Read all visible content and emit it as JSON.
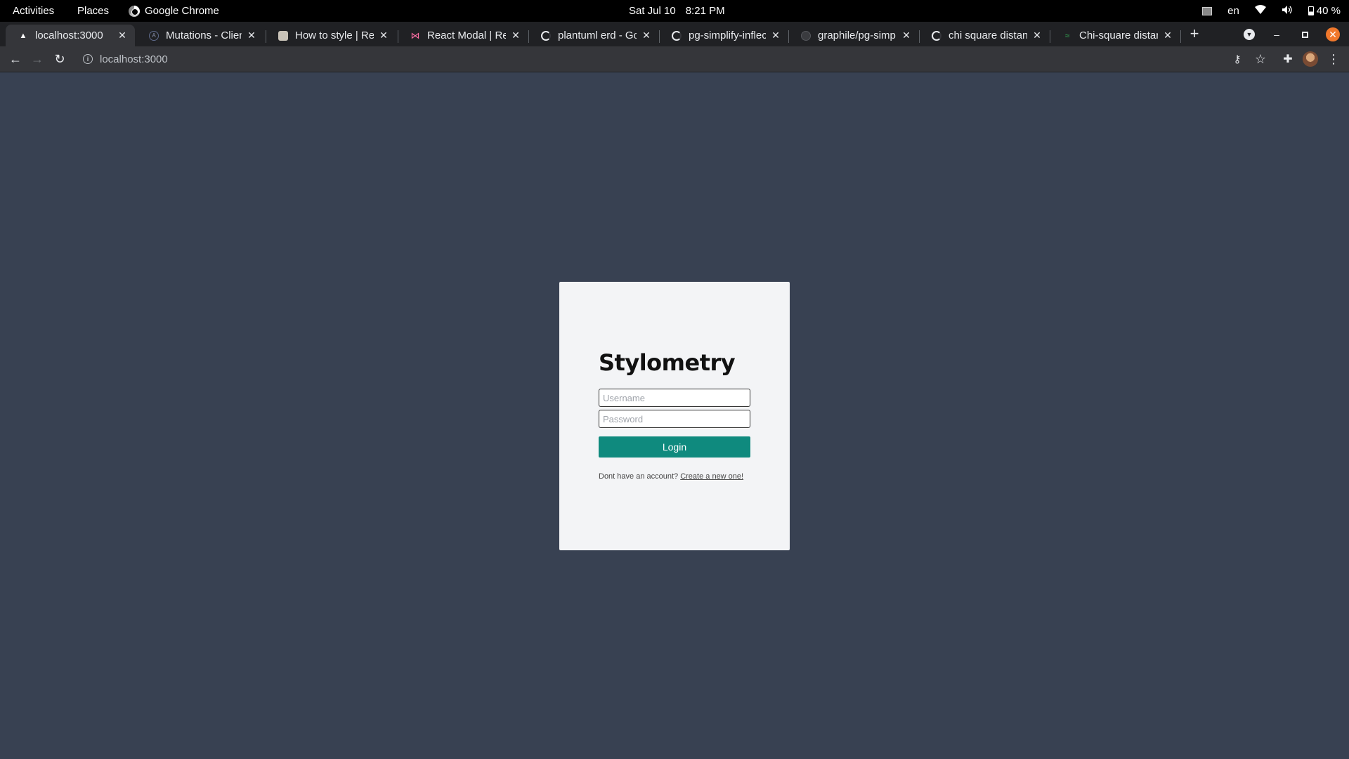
{
  "system_bar": {
    "activities": "Activities",
    "places": "Places",
    "app_name": "Google Chrome",
    "date": "Sat Jul 10",
    "time": "8:21 PM",
    "language": "en",
    "battery": "40 %"
  },
  "tabs": [
    {
      "title": "localhost:3000",
      "active": true,
      "favicon": "triangle-icon"
    },
    {
      "title": "Mutations - Client",
      "active": false,
      "favicon": "apollo-icon"
    },
    {
      "title": "How to style | Rea",
      "active": false,
      "favicon": "styled-icon"
    },
    {
      "title": "React Modal | Rea",
      "active": false,
      "favicon": "bow-icon"
    },
    {
      "title": "plantuml erd - Go",
      "active": false,
      "favicon": "google-icon"
    },
    {
      "title": "pg-simplify-inflec",
      "active": false,
      "favicon": "google-icon"
    },
    {
      "title": "graphile/pg-simp",
      "active": false,
      "favicon": "github-icon"
    },
    {
      "title": "chi square distanc",
      "active": false,
      "favicon": "google-icon"
    },
    {
      "title": "Chi-square distan",
      "active": false,
      "favicon": "leaf-icon"
    }
  ],
  "address_bar": {
    "url": "localhost:3000"
  },
  "login": {
    "title": "Stylometry",
    "username_placeholder": "Username",
    "password_placeholder": "Password",
    "button_label": "Login",
    "signup_prompt": "Dont have an account?",
    "signup_link": "Create a new one!"
  },
  "colors": {
    "page_background": "#384152",
    "card_background": "#f3f4f6",
    "accent": "#0f8a7e"
  }
}
